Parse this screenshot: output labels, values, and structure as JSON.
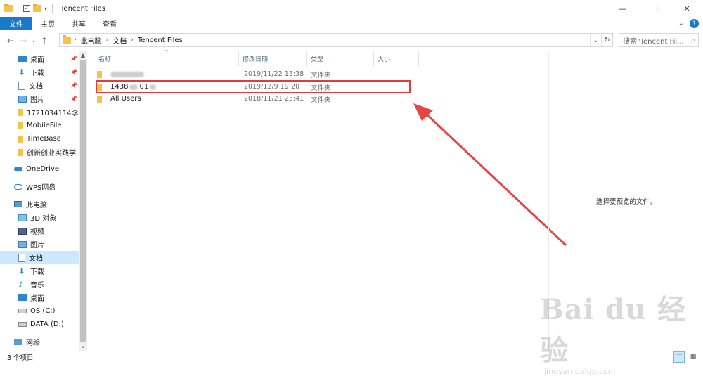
{
  "window": {
    "title": "Tencent Files",
    "minimize": "—",
    "maximize": "☐",
    "close": "✕"
  },
  "ribbon": {
    "tabs": [
      "文件",
      "主页",
      "共享",
      "查看"
    ],
    "expand": "⌄",
    "help": "?"
  },
  "nav": {
    "back": "←",
    "forward": "→",
    "recent": "⌄",
    "up": "↑",
    "breadcrumb": [
      "此电脑",
      "文档",
      "Tencent Files"
    ],
    "dropdown": "⌄",
    "refresh": "↻",
    "search_placeholder": "搜索\"Tencent Fil...",
    "search_icon": "⌕"
  },
  "sidebar": {
    "items": [
      {
        "label": "桌面",
        "icon": "desktop-icon",
        "pinned": true
      },
      {
        "label": "下载",
        "icon": "download-icon",
        "pinned": true
      },
      {
        "label": "文档",
        "icon": "document-icon",
        "pinned": true
      },
      {
        "label": "图片",
        "icon": "picture-icon",
        "pinned": true
      },
      {
        "label": "1721034114李",
        "icon": "folder-icon",
        "pinned": false
      },
      {
        "label": "MobileFile",
        "icon": "folder-icon",
        "pinned": false
      },
      {
        "label": "TimeBase",
        "icon": "folder-icon",
        "pinned": false
      },
      {
        "label": "创新创业实践学",
        "icon": "folder-icon",
        "pinned": false
      },
      {
        "label": "OneDrive",
        "icon": "cloud-icon",
        "pinned": false
      },
      {
        "label": "WPS网盘",
        "icon": "wps-cloud-icon",
        "pinned": false
      },
      {
        "label": "此电脑",
        "icon": "computer-icon",
        "pinned": false
      },
      {
        "label": "3D 对象",
        "icon": "3d-objects-icon",
        "pinned": false
      },
      {
        "label": "视频",
        "icon": "video-icon",
        "pinned": false
      },
      {
        "label": "图片",
        "icon": "picture-icon",
        "pinned": false
      },
      {
        "label": "文档",
        "icon": "document-icon",
        "pinned": false
      },
      {
        "label": "下载",
        "icon": "download-icon",
        "pinned": false
      },
      {
        "label": "音乐",
        "icon": "music-icon",
        "pinned": false
      },
      {
        "label": "桌面",
        "icon": "desktop-icon",
        "pinned": false
      },
      {
        "label": "OS (C:)",
        "icon": "drive-c-icon",
        "pinned": false
      },
      {
        "label": "DATA (D:)",
        "icon": "drive-d-icon",
        "pinned": false
      },
      {
        "label": "网络",
        "icon": "network-icon",
        "pinned": false
      }
    ],
    "pin_glyph": "📌"
  },
  "columns": {
    "name": "名称",
    "date": "修改日期",
    "type": "类型",
    "size": "大小",
    "sort_glyph": "^"
  },
  "files": [
    {
      "name_visible": "",
      "date": "2019/11/22 13:38",
      "type": "文件夹"
    },
    {
      "name_visible": "1438",
      "name_tail": "01",
      "date": "2019/12/9 19:20",
      "type": "文件夹"
    },
    {
      "name_visible": "All Users",
      "date": "2018/11/21 23:41",
      "type": "文件夹"
    }
  ],
  "preview": {
    "empty_text": "选择要预览的文件。"
  },
  "status": {
    "count": "3 个项目"
  },
  "watermark": {
    "main": "Bai du 经验",
    "sub": "jingyan.baidu.com"
  },
  "colors": {
    "accent": "#1979ca",
    "selection": "#cce8ff",
    "highlight": "#e03c3c",
    "folder": "#f3c34a"
  }
}
